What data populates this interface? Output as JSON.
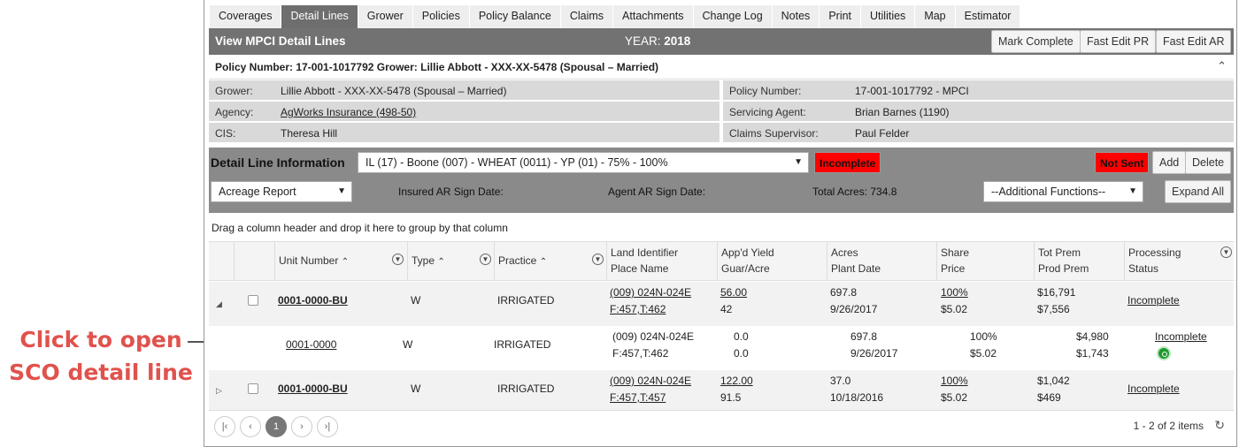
{
  "callout": {
    "line1": "Click to open",
    "line2": "SCO detail line"
  },
  "tabs": [
    "Coverages",
    "Detail Lines",
    "Grower",
    "Policies",
    "Policy Balance",
    "Claims",
    "Attachments",
    "Change Log",
    "Notes",
    "Print",
    "Utilities",
    "Map",
    "Estimator"
  ],
  "active_tab": "Detail Lines",
  "titlebar": {
    "title": "View MPCI Detail Lines",
    "year_label": "YEAR:",
    "year": "2018",
    "mark_complete": "Mark Complete",
    "fast_edit_pr": "Fast Edit PR",
    "fast_edit_ar": "Fast Edit AR"
  },
  "policy_header": {
    "text": "Policy Number: 17-001-1017792 Grower: Lillie Abbott - XXX-XX-5478 (Spousal – Married)",
    "collapse_icon": "chevron-up-icon"
  },
  "info": {
    "grower_label": "Grower:",
    "grower": "Lillie Abbott - XXX-XX-5478 (Spousal – Married)",
    "policy_label": "Policy Number:",
    "policy": "17-001-1017792 - MPCI",
    "agency_label": "Agency:",
    "agency": "AgWorks Insurance (498-50)",
    "servicing_label": "Servicing Agent:",
    "servicing": "Brian Barnes (1190)",
    "cis_label": "CIS:",
    "cis": "Theresa Hill",
    "claims_label": "Claims Supervisor:",
    "claims": "Paul Felder"
  },
  "detail": {
    "label": "Detail Line Information",
    "line_select": "IL (17) - Boone (007) - WHEAT (0011) - YP (01) - 75% - 100%",
    "status": "Incomplete",
    "not_sent": "Not Sent",
    "add": "Add",
    "delete": "Delete",
    "report_select": "Acreage Report",
    "insured_sign": "Insured AR Sign Date:",
    "agent_sign": "Agent AR Sign Date:",
    "total_acres": "Total Acres: 734.8",
    "additional": "--Additional Functions--",
    "expand_all": "Expand All"
  },
  "grid": {
    "group_hint": "Drag a column header and drop it here to group by that column",
    "headers": {
      "unit": "Unit Number",
      "type": "Type",
      "practice": "Practice",
      "land1": "Land Identifier",
      "land2": "Place Name",
      "yield1": "App'd Yield",
      "yield2": "Guar/Acre",
      "acres1": "Acres",
      "acres2": "Plant Date",
      "share1": "Share",
      "share2": "Price",
      "prem1": "Tot Prem",
      "prem2": "Prod Prem",
      "proc1": "Processing",
      "proc2": "Status"
    },
    "rows": [
      {
        "unit": "0001-0000-BU",
        "type": "W",
        "practice": "IRRIGATED",
        "land": "(009) 024N-024E",
        "place": "F:457,T:462",
        "yield": "56.00",
        "guar": "42",
        "acres": "697.8",
        "plant": "9/26/2017",
        "share": "100%",
        "price": "$5.02",
        "tot": "$16,791",
        "prod": "$7,556",
        "status": "Incomplete"
      },
      {
        "unit": "0001-0000",
        "type": "W",
        "practice": "IRRIGATED",
        "land": "(009) 024N-024E",
        "place": "F:457,T:462",
        "yield": "0.0",
        "guar": "0.0",
        "acres": "697.8",
        "plant": "9/26/2017",
        "share": "100%",
        "price": "$5.02",
        "tot": "$4,980",
        "prod": "$1,743",
        "status": "Incomplete"
      },
      {
        "unit": "0001-0000-BU",
        "type": "W",
        "practice": "IRRIGATED",
        "land": "(009) 024N-024E",
        "place": "F:457,T:457",
        "yield": "122.00",
        "guar": "91.5",
        "acres": "37.0",
        "plant": "10/18/2016",
        "share": "100%",
        "price": "$5.02",
        "tot": "$1,042",
        "prod": "$469",
        "status": "Incomplete"
      }
    ]
  },
  "pager": {
    "current": "1",
    "summary": "1 - 2 of 2 items"
  }
}
